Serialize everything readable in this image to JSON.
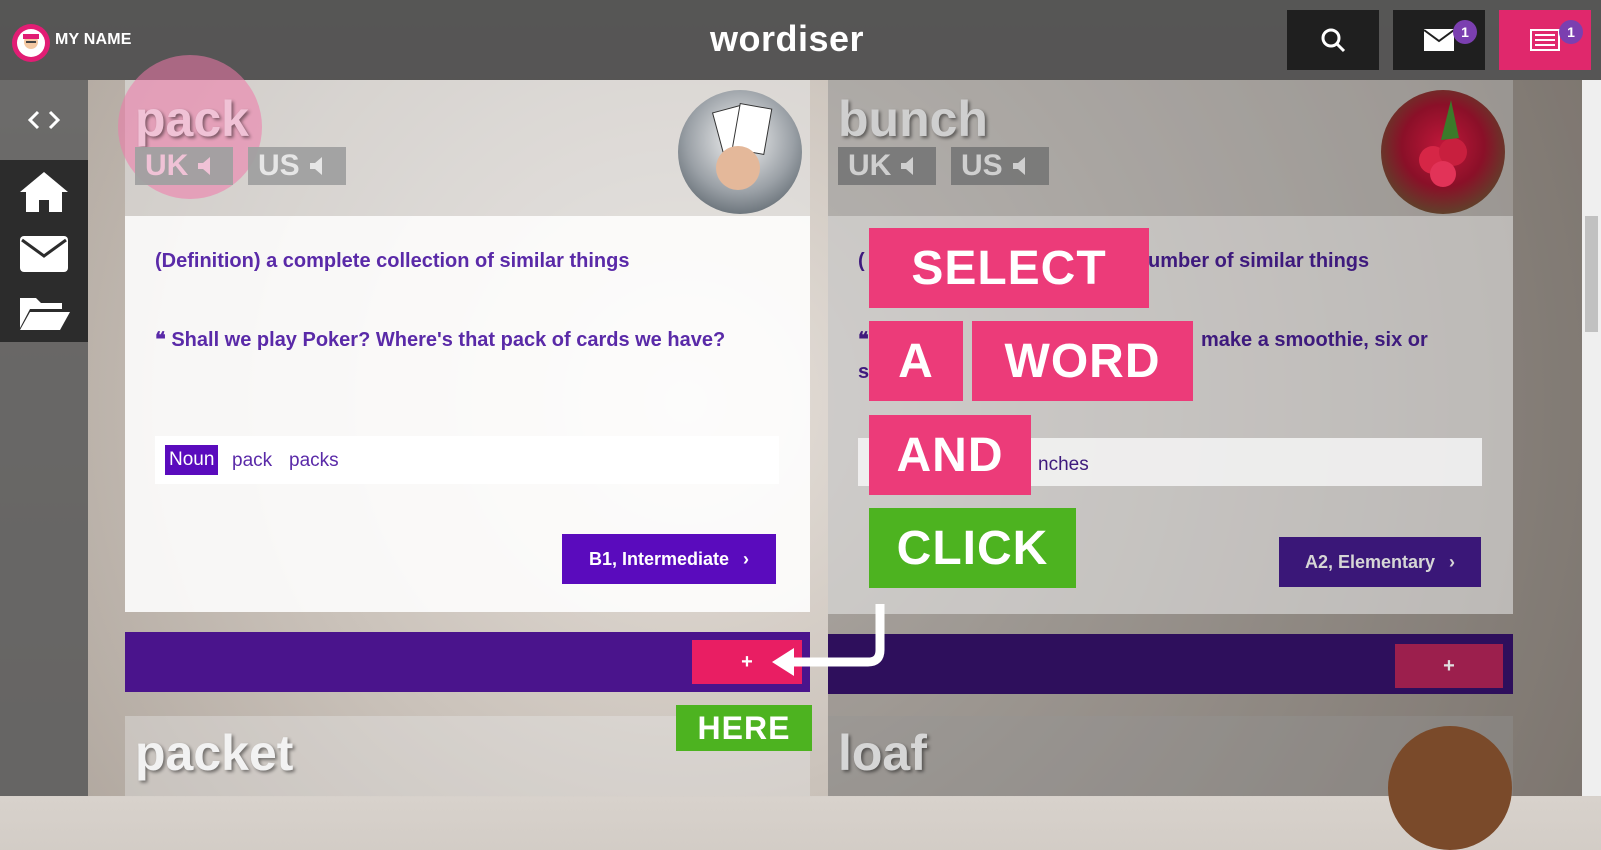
{
  "header": {
    "user_name": "MY NAME",
    "logo_text": "wordiser",
    "mail_badge": "1",
    "list_badge": "1",
    "icons": [
      "search-icon",
      "mail-icon",
      "list-icon"
    ]
  },
  "sidebar": {
    "icons": [
      "code-toggle-icon",
      "home-icon",
      "mail-icon",
      "folder-open-icon"
    ]
  },
  "cards": [
    {
      "word": "pack",
      "uk_label": "UK",
      "us_label": "US",
      "definition": "(Definition) a complete collection of similar things",
      "example": "Shall we play Poker? Where's that pack of cards we have?",
      "pos": "Noun",
      "forms": [
        "pack",
        "packs"
      ],
      "level": "B1, Intermediate",
      "plus": "+"
    },
    {
      "word": "bunch",
      "uk_label": "UK",
      "us_label": "US",
      "definition_visible": "(",
      "definition_tail": "umber of similar things",
      "example_tail": "make a smoothie, six or",
      "example_start": "s",
      "forms_tail": "nches",
      "level": "A2, Elementary",
      "plus": "+"
    }
  ],
  "next_words": [
    "packet",
    "loaf"
  ],
  "instructions": {
    "select": "SELECT",
    "a": "A",
    "word": "WORD",
    "and": "AND",
    "click": "CLICK",
    "here": "HERE"
  },
  "colors": {
    "accent_pink": "#ec3b79",
    "accent_green": "#4db320",
    "primary_purple": "#5a0bbd",
    "bar_purple": "#4a148c"
  }
}
